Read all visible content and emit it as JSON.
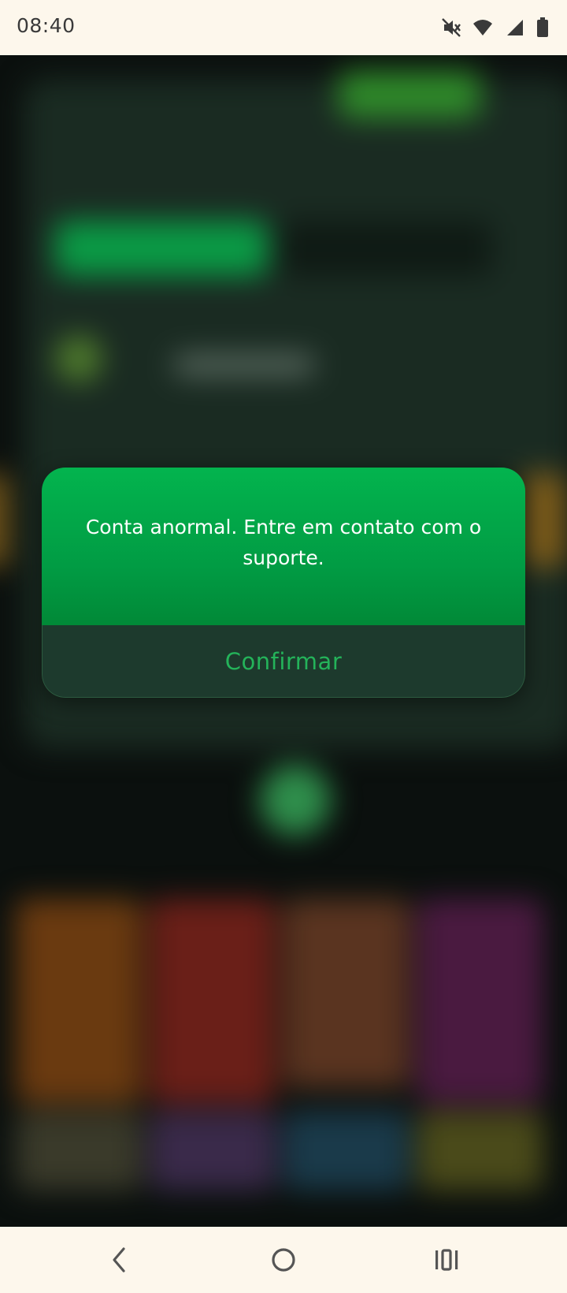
{
  "status_bar": {
    "time": "08:40",
    "icons": [
      "mute-icon",
      "wifi-icon",
      "signal-icon",
      "battery-icon"
    ]
  },
  "dialog": {
    "message": "Conta anormal. Entre em contato com o suporte.",
    "confirm_label": "Confirmar",
    "colors": {
      "header_top": "#03b44e",
      "header_bottom": "#018937",
      "footer": "#1d3a2d",
      "confirm_text": "#24b35a"
    }
  },
  "navigation_bar": {
    "buttons": [
      "back-icon",
      "home-icon",
      "recents-icon"
    ]
  }
}
